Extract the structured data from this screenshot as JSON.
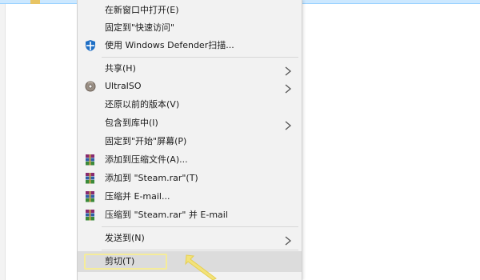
{
  "menu": {
    "items": [
      {
        "label": "在新窗口中打开(E)",
        "icon": "none"
      },
      {
        "label": "固定到\"快速访问\"",
        "icon": "none"
      },
      {
        "label": "使用 Windows Defender扫描...",
        "icon": "windows-defender-shield-icon"
      },
      {
        "label": "共享(H)",
        "icon": "none",
        "submenu": true
      },
      {
        "label": "UltraISO",
        "icon": "ultraiso-disc-icon",
        "submenu": true
      },
      {
        "label": "还原以前的版本(V)",
        "icon": "none"
      },
      {
        "label": "包含到库中(I)",
        "icon": "none",
        "submenu": true
      },
      {
        "label": "固定到\"开始\"屏幕(P)",
        "icon": "none"
      },
      {
        "label": "添加到压缩文件(A)...",
        "icon": "winrar-books-icon"
      },
      {
        "label": "添加到 \"Steam.rar\"(T)",
        "icon": "winrar-books-icon"
      },
      {
        "label": "压缩并 E-mail...",
        "icon": "winrar-books-icon"
      },
      {
        "label": "压缩到 \"Steam.rar\" 并 E-mail",
        "icon": "winrar-books-icon"
      },
      {
        "label": "发送到(N)",
        "icon": "none",
        "submenu": true
      },
      {
        "label": "剪切(T)",
        "icon": "none",
        "highlighted": true
      }
    ]
  },
  "colors": {
    "menu_background": "#f2f2f2",
    "hover_background": "#dcdcdc",
    "highlight_outline": "#f5ec9a",
    "pointer_arrow": "#f2e27a",
    "selection_strip": "#cce8ff"
  }
}
